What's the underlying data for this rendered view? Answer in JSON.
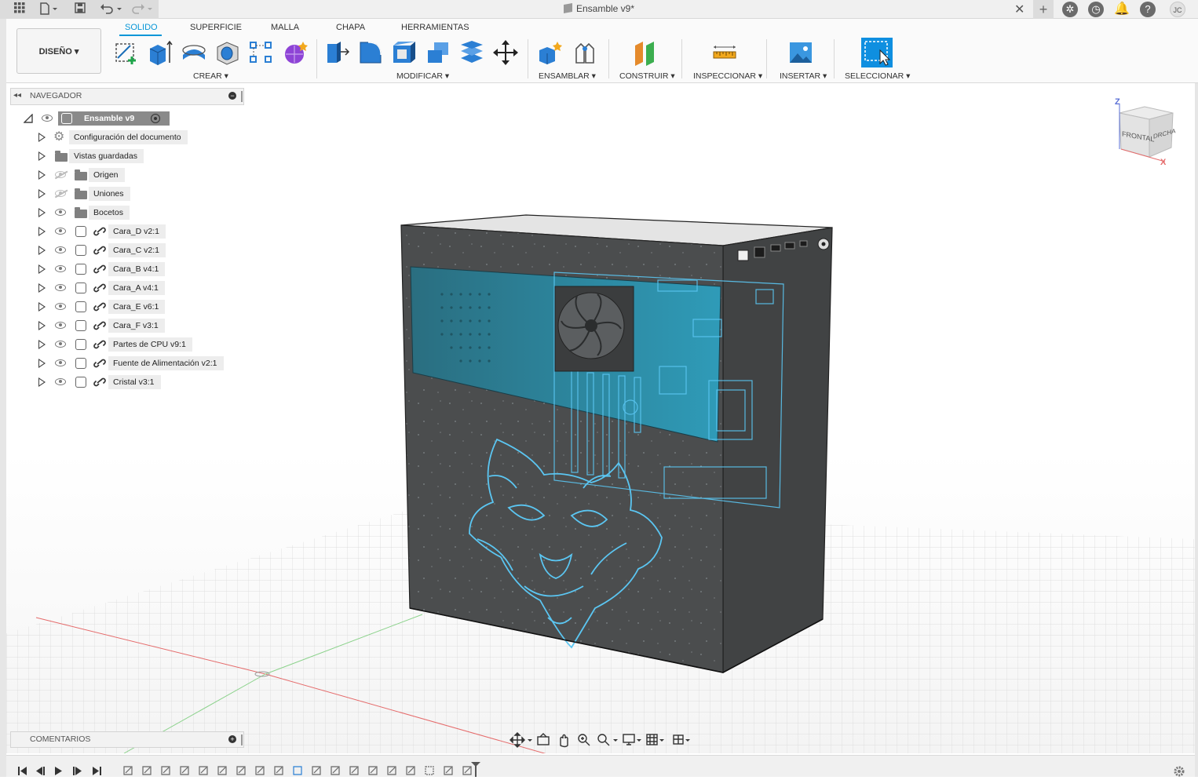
{
  "window": {
    "title": "Ensamble v9*",
    "user_initials": "JC"
  },
  "workspace": {
    "label": "DISEÑO ▾"
  },
  "tabs": [
    {
      "label": "SOLIDO",
      "active": true
    },
    {
      "label": "SUPERFICIE",
      "active": false
    },
    {
      "label": "MALLA",
      "active": false
    },
    {
      "label": "CHAPA",
      "active": false
    },
    {
      "label": "HERRAMIENTAS",
      "active": false
    }
  ],
  "groups": {
    "crear": "CREAR ▾",
    "modificar": "MODIFICAR ▾",
    "ensamblar": "ENSAMBLAR ▾",
    "construir": "CONSTRUIR ▾",
    "inspeccionar": "INSPECCIONAR ▾",
    "insertar": "INSERTAR ▾",
    "seleccionar": "SELECCIONAR ▾"
  },
  "browser": {
    "title": "NAVEGADOR",
    "root": "Ensamble v9",
    "items": [
      {
        "label": "Configuración del documento",
        "kind": "settings"
      },
      {
        "label": "Vistas guardadas",
        "kind": "folder"
      },
      {
        "label": "Origen",
        "kind": "folder",
        "hidden": true
      },
      {
        "label": "Uniones",
        "kind": "folder",
        "hidden": true
      },
      {
        "label": "Bocetos",
        "kind": "folder"
      },
      {
        "label": "Cara_D v2:1",
        "kind": "component"
      },
      {
        "label": "Cara_C v2:1",
        "kind": "component"
      },
      {
        "label": "Cara_B v4:1",
        "kind": "component"
      },
      {
        "label": "Cara_A v4:1",
        "kind": "component"
      },
      {
        "label": "Cara_E v6:1",
        "kind": "component"
      },
      {
        "label": "Cara_F v3:1",
        "kind": "component"
      },
      {
        "label": "Partes de CPU v9:1",
        "kind": "assembly"
      },
      {
        "label": "Fuente de Alimentación v2:1",
        "kind": "component"
      },
      {
        "label": "Cristal v3:1",
        "kind": "component"
      }
    ]
  },
  "comments": {
    "title": "COMENTARIOS"
  },
  "viewcube": {
    "front": "FRONTAL",
    "right": "DRCHA",
    "z": "Z",
    "x": "X"
  },
  "colors": {
    "accent": "#0696d7",
    "engraving": "#5bc6f2",
    "case": "#4a4c4d",
    "glass": "#2d8fa8"
  }
}
